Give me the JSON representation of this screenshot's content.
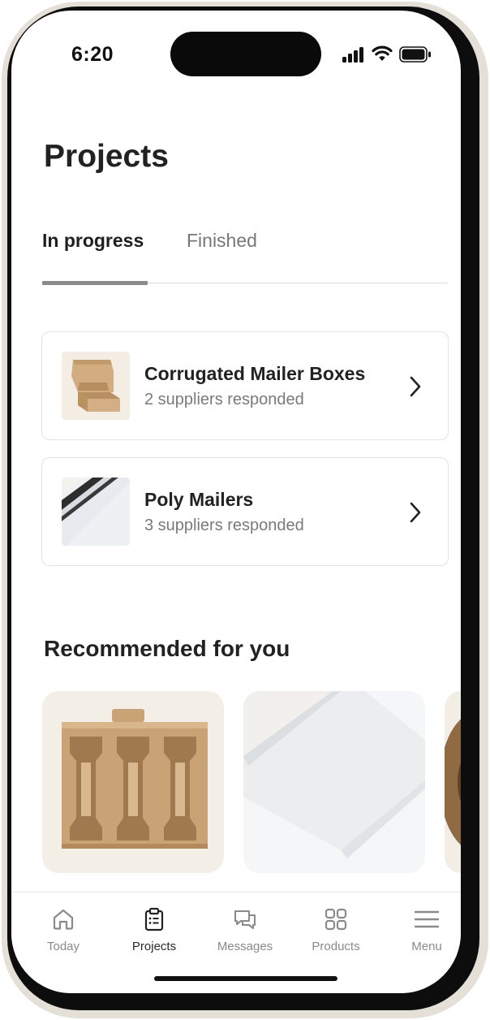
{
  "status_bar": {
    "time": "6:20"
  },
  "header": {
    "title": "Projects"
  },
  "tabs": [
    {
      "label": "In progress",
      "active": true
    },
    {
      "label": "Finished",
      "active": false
    }
  ],
  "projects": [
    {
      "name": "Corrugated Mailer Boxes",
      "status": "2 suppliers responded",
      "thumbnail": "kraft-mailer-box"
    },
    {
      "name": "Poly Mailers",
      "status": "3 suppliers responded",
      "thumbnail": "white-poly-mailer"
    }
  ],
  "recommended": {
    "title": "Recommended for you",
    "items": [
      {
        "image": "cardboard-bottle-insert"
      },
      {
        "image": "white-envelope-mailer"
      },
      {
        "image": "kraft-paper-tape-roll"
      }
    ]
  },
  "nav": [
    {
      "label": "Today",
      "icon": "home-icon",
      "active": false
    },
    {
      "label": "Projects",
      "icon": "clipboard-icon",
      "active": true
    },
    {
      "label": "Messages",
      "icon": "chat-bubbles-icon",
      "active": false
    },
    {
      "label": "Products",
      "icon": "grid-icon",
      "active": false
    },
    {
      "label": "Menu",
      "icon": "hamburger-menu-icon",
      "active": false
    }
  ],
  "colors": {
    "accent_text": "#222222",
    "muted_text": "#7a7a7a",
    "kraft": "#c9a276",
    "frame": "#e4e0d8"
  }
}
